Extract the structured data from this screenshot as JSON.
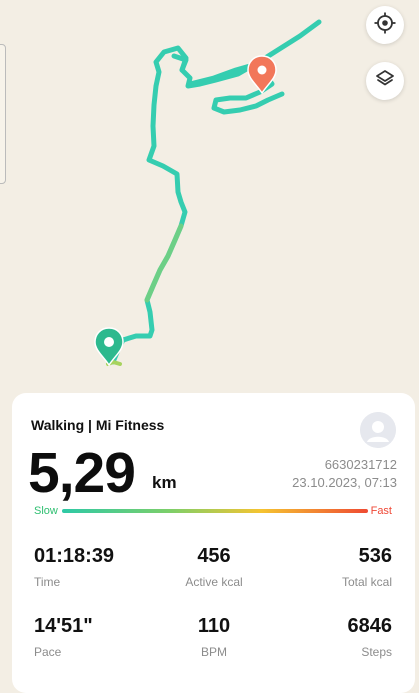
{
  "map": {
    "locate_button_icon": "crosshair-target-icon",
    "layers_button_icon": "layers-icon",
    "start_marker_icon": "start-pin-icon",
    "end_marker_icon": "end-pin-icon",
    "route_color": "#35cdb0",
    "start_color": "#2db98e",
    "end_color": "#f2775a"
  },
  "card": {
    "title": "Walking | Mi Fitness",
    "avatar_icon": "user-avatar-icon",
    "distance": "5,29",
    "distance_unit": "km",
    "record_id": "6630231712",
    "datetime": "23.10.2023, 07:13",
    "pace_scale": {
      "slow_label": "Slow",
      "fast_label": "Fast",
      "slow_color": "#2fbf71",
      "fast_color": "#ef4836"
    },
    "stats": [
      {
        "value": "01:18:39",
        "label": "Time"
      },
      {
        "value": "456",
        "label": "Active kcal"
      },
      {
        "value": "536",
        "label": "Total kcal"
      },
      {
        "value": "14'51\"",
        "label": "Pace"
      },
      {
        "value": "110",
        "label": "BPM"
      },
      {
        "value": "6846",
        "label": "Steps"
      }
    ]
  }
}
